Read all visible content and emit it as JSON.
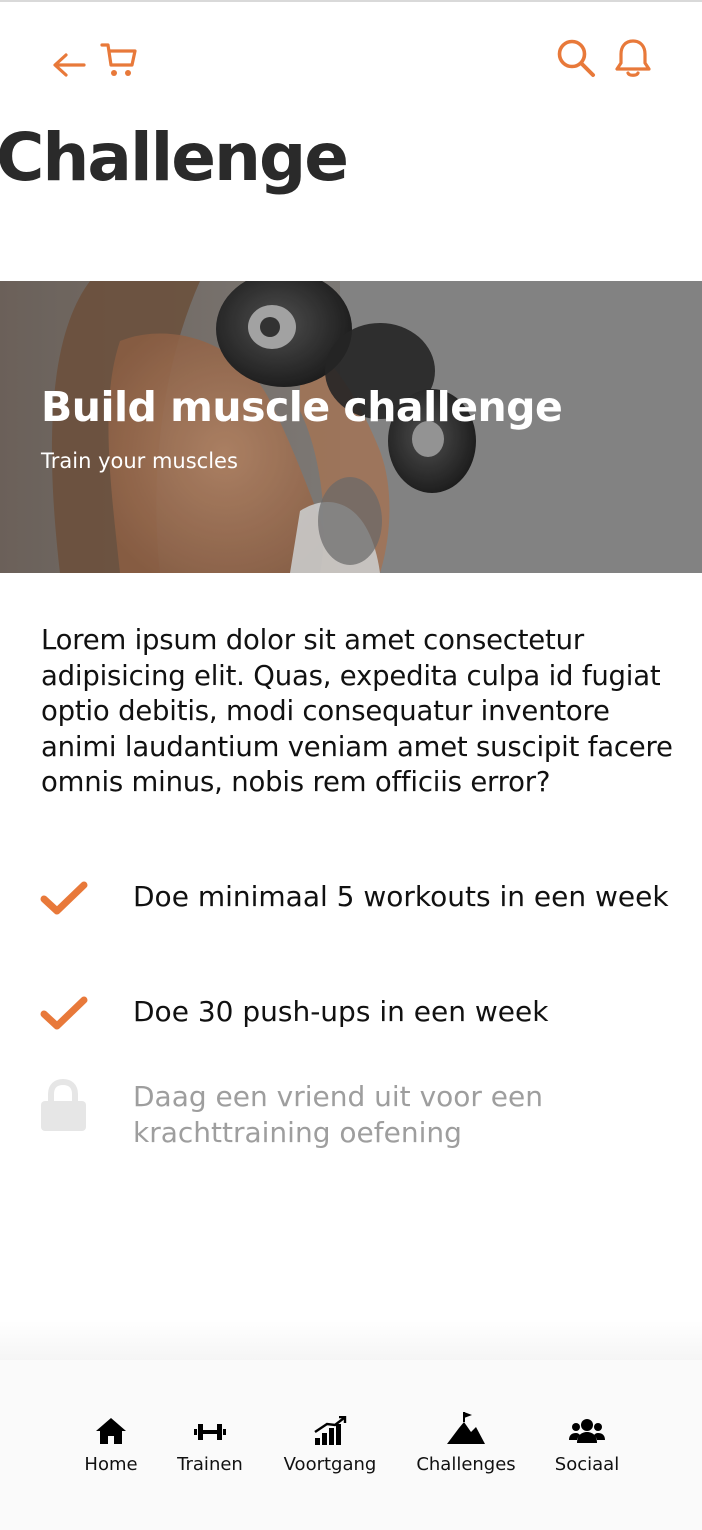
{
  "header": {
    "title": "Challenge",
    "icons": [
      "back-arrow-icon",
      "cart-icon",
      "search-icon",
      "bell-icon"
    ],
    "accent_color": "#e8793a"
  },
  "hero": {
    "title": "Build muscle challenge",
    "subtitle": "Train your muscles"
  },
  "description": "Lorem ipsum dolor sit amet consectetur adipisicing elit. Quas, expedita culpa id fugiat optio debitis, modi consequatur inventore animi laudantium veniam amet suscipit facere omnis minus, nobis rem officiis error?",
  "requirements": [
    {
      "text": "Doe minimaal 5 workouts in een week",
      "status": "completed",
      "icon": "check-icon"
    },
    {
      "text": "Doe 30 push-ups in een week",
      "status": "completed",
      "icon": "check-icon"
    },
    {
      "text": "Daag een vriend uit voor een krachttraining oefening",
      "status": "locked",
      "icon": "lock-icon"
    }
  ],
  "bottom_nav": {
    "items": [
      {
        "label": "Home",
        "icon": "home-icon"
      },
      {
        "label": "Trainen",
        "icon": "dumbbell-icon"
      },
      {
        "label": "Voortgang",
        "icon": "progress-chart-icon"
      },
      {
        "label": "Challenges",
        "icon": "mountain-flag-icon"
      },
      {
        "label": "Sociaal",
        "icon": "users-icon"
      }
    ]
  }
}
